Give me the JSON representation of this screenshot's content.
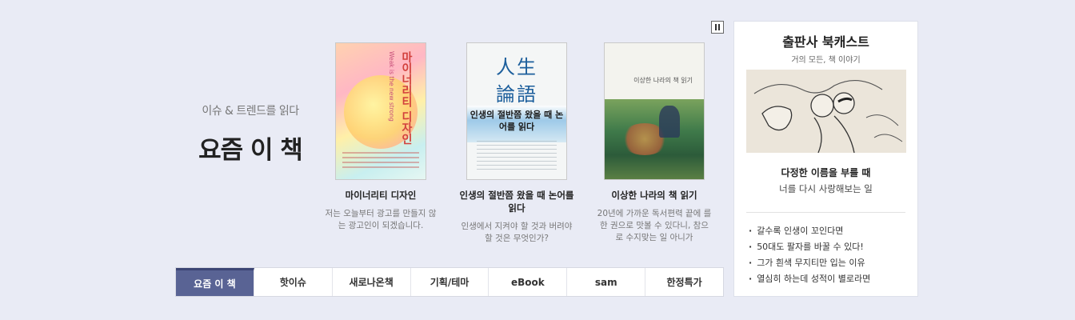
{
  "section": {
    "subtitle": "이슈 & 트렌드를 읽다",
    "title": "요즘 이 책"
  },
  "books": [
    {
      "title": "마이너리티 디자인",
      "description": "저는 오늘부터 광고를 만들지 않는 광고인이 되겠습니다.",
      "cover": {
        "vertical_title": "마이너리티 디자인",
        "vertical_small": "Weak is the new strong"
      }
    },
    {
      "title": "인생의 절반쯤 왔을 때 논어를 읽다",
      "description": "인생에서 지켜야 할 것과 버려야 할 것은 무엇인가?",
      "cover": {
        "hanja_line1": "人生",
        "hanja_line2": "論語",
        "korean_title": "인생의 절반쯤 왔을 때 논어를 읽다"
      }
    },
    {
      "title": "이상한 나라의 책 읽기",
      "description": "20년에 가까운 독서편력 끝에 를 한 권으로 맛볼 수 있다니, 참으로 수지맞는 일 아니가",
      "cover": {
        "small_title": "이상한 나라의 책 읽기"
      }
    }
  ],
  "tabs": [
    {
      "label": "요즘 이 책",
      "active": true
    },
    {
      "label": "핫이슈",
      "active": false
    },
    {
      "label": "새로나온책",
      "active": false
    },
    {
      "label": "기획/테마",
      "active": false
    },
    {
      "label": "eBook",
      "active": false
    },
    {
      "label": "sam",
      "active": false
    },
    {
      "label": "한정특가",
      "active": false
    }
  ],
  "podcast": {
    "title": "출판사 북캐스트",
    "subtitle": "거의 모든, 책 이야기",
    "episode_title": "다정한 이름을 부를 때",
    "episode_subtitle": "너를 다시 사랑해보는 일",
    "items": [
      "갈수록 인생이 꼬인다면",
      "50대도 팔자를 바꿀 수 있다!",
      "그가 흰색 무지티만 입는 이유",
      "열심히 하는데 성적이 별로라면"
    ]
  },
  "colors": {
    "page_background": "#e9ebf5",
    "active_tab": "#596394"
  },
  "icons": {
    "pause": "pause-icon"
  }
}
